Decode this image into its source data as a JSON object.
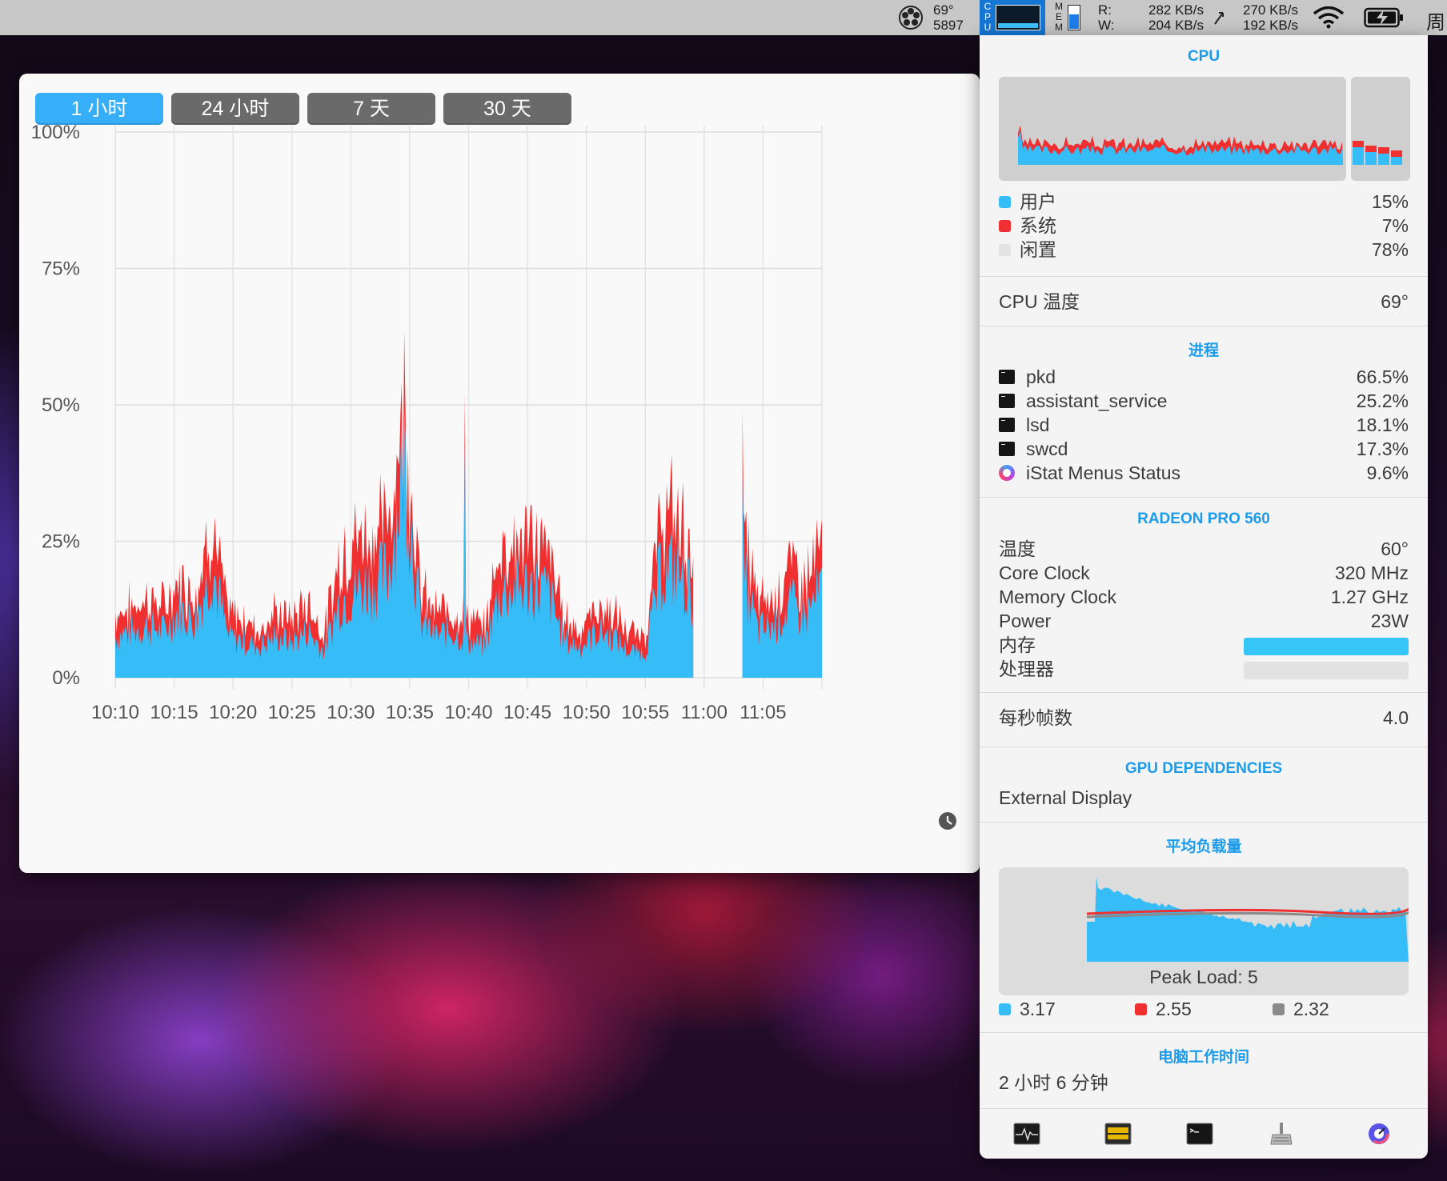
{
  "menubar": {
    "temp": "69°",
    "fan_rpm": "5897",
    "cpu_label": "CPU",
    "mem_label": "MEM",
    "disk_read_label": "R:",
    "disk_write_label": "W:",
    "disk_read": "282 KB/s",
    "disk_write": "204 KB/s",
    "net_up": "270 KB/s",
    "net_down": "192 KB/s",
    "clock": "周"
  },
  "history": {
    "tabs": [
      {
        "label": "1 小时",
        "active": true
      },
      {
        "label": "24 小时",
        "active": false
      },
      {
        "label": "7 天",
        "active": false
      },
      {
        "label": "30 天",
        "active": false
      }
    ]
  },
  "chart_data": {
    "type": "area",
    "title": "",
    "xlabel": "",
    "ylabel": "",
    "yticks": [
      "100%",
      "75%",
      "50%",
      "25%",
      "0%"
    ],
    "ylim": [
      0,
      100
    ],
    "x": [
      "10:10",
      "10:15",
      "10:20",
      "10:25",
      "10:30",
      "10:35",
      "10:40",
      "10:45",
      "10:50",
      "10:55",
      "11:00",
      "11:05"
    ],
    "series": [
      {
        "color": "#36bdf8",
        "values": [
          8,
          9,
          10,
          9,
          13,
          11,
          22,
          8,
          7,
          6,
          8,
          7,
          9,
          5,
          15,
          17,
          18,
          20,
          43,
          11,
          8,
          9,
          7,
          6,
          17,
          17,
          18,
          16,
          7,
          6,
          9,
          8,
          5,
          5,
          21,
          21,
          16,
          null,
          null,
          21,
          9,
          10,
          14,
          12,
          17
        ]
      },
      {
        "color": "#f03030",
        "values": [
          4,
          4,
          5,
          4,
          5,
          5,
          8,
          4,
          4,
          3,
          4,
          4,
          5,
          3,
          8,
          9,
          9,
          9,
          10,
          5,
          4,
          4,
          4,
          3,
          8,
          8,
          8,
          7,
          4,
          3,
          4,
          4,
          3,
          3,
          9,
          9,
          7,
          null,
          null,
          8,
          5,
          5,
          7,
          6,
          8
        ]
      }
    ],
    "spikes": [
      [
        0.495,
        52
      ],
      [
        0.888,
        49
      ]
    ],
    "x_start": "10:10",
    "x_end": "11:10",
    "grid": true,
    "legend": "none",
    "corner_icon": "clock-icon"
  },
  "cpu": {
    "title": "CPU",
    "user_label": "用户",
    "user_value": "15%",
    "user_color": "#36bdf8",
    "system_label": "系统",
    "system_value": "7%",
    "system_color": "#f03030",
    "idle_label": "闲置",
    "idle_value": "78%",
    "idle_color": "#e3e3e3",
    "temp_label": "CPU 温度",
    "temp_value": "69°"
  },
  "processes": {
    "title": "进程",
    "items": [
      {
        "name": "pkd",
        "value": "66.5%",
        "icon": "terminal-icon"
      },
      {
        "name": "assistant_service",
        "value": "25.2%",
        "icon": "terminal-icon"
      },
      {
        "name": "lsd",
        "value": "18.1%",
        "icon": "terminal-icon"
      },
      {
        "name": "swcd",
        "value": "17.3%",
        "icon": "terminal-icon"
      },
      {
        "name": "iStat Menus Status",
        "value": "9.6%",
        "icon": "istat-icon"
      }
    ]
  },
  "gpu": {
    "title": "RADEON PRO 560",
    "temp_label": "温度",
    "temp_value": "60°",
    "core_label": "Core Clock",
    "core_value": "320 MHz",
    "mem_clock_label": "Memory Clock",
    "mem_clock_value": "1.27 GHz",
    "power_label": "Power",
    "power_value": "23W",
    "memory_label": "内存",
    "memory_level": 1.0,
    "processor_label": "处理器",
    "processor_level": 0.0,
    "fps_label": "每秒帧数",
    "fps_value": "4.0"
  },
  "gpu_deps": {
    "title": "GPU DEPENDENCIES",
    "item": "External Display"
  },
  "load": {
    "title": "平均负载量",
    "peak": "Peak Load: 5",
    "avg1": "3.17",
    "avg1_color": "#36bdf8",
    "avg5": "2.55",
    "avg5_color": "#f03030",
    "avg15": "2.32",
    "avg15_color": "#8a8a8a"
  },
  "uptime": {
    "title": "电脑工作时间",
    "value": "2 小时 6 分钟"
  },
  "bottom_icons": [
    "activity-monitor-icon",
    "console-icon",
    "terminal-icon",
    "cleanup-icon",
    "istat-icon"
  ]
}
